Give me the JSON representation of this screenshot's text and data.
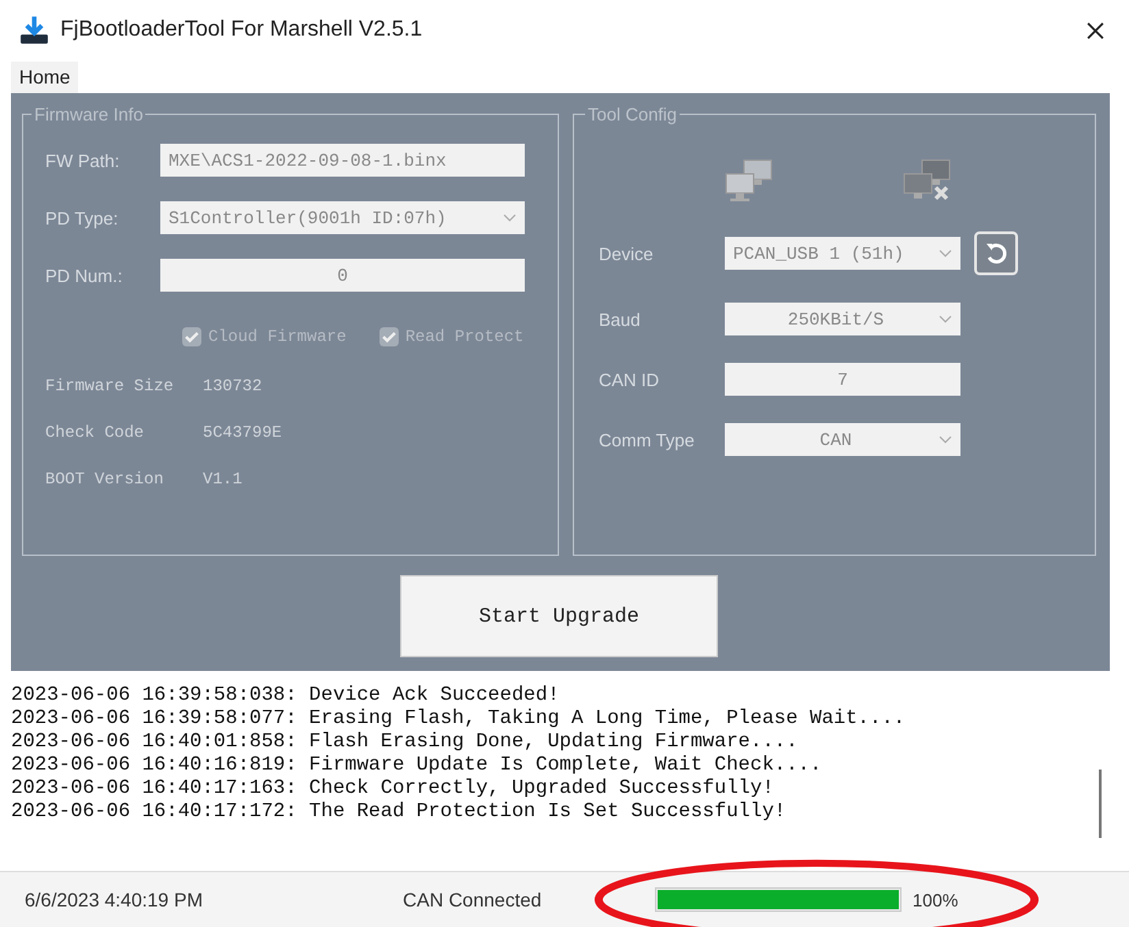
{
  "window": {
    "title": "FjBootloaderTool For Marshell V2.5.1"
  },
  "menu": [
    {
      "label": "Home",
      "selected": true
    }
  ],
  "firmware_info": {
    "title": "Firmware Info",
    "fields": [
      {
        "label": "FW Path:",
        "value": "MXE\\ACS1-2022-09-08-1.binx",
        "kind": "text"
      },
      {
        "label": "PD Type:",
        "value": "S1Controller(9001h ID:07h)",
        "kind": "dropdown"
      },
      {
        "label": "PD Num.:",
        "value": "0",
        "kind": "text"
      }
    ],
    "checkboxes": [
      {
        "label": "Cloud Firmware",
        "checked": true,
        "disabled": true
      },
      {
        "label": "Read Protect",
        "checked": true,
        "disabled": true
      }
    ],
    "info": [
      {
        "label": "Firmware Size",
        "value": "130732"
      },
      {
        "label": "Check Code",
        "value": "5C43799E"
      },
      {
        "label": "BOOT Version",
        "value": "V1.1"
      }
    ]
  },
  "tool_config": {
    "title": "Tool Config",
    "fields": [
      {
        "label": "Device",
        "value": "PCAN_USB 1 (51h)",
        "kind": "dropdown",
        "refresh": true
      },
      {
        "label": "Baud",
        "value": "250KBit/S",
        "kind": "dropdown",
        "refresh": false
      },
      {
        "label": "CAN ID",
        "value": "7",
        "kind": "text",
        "refresh": false
      },
      {
        "label": "Comm Type",
        "value": "CAN",
        "kind": "dropdown",
        "refresh": false
      }
    ]
  },
  "start_button": "Start Upgrade",
  "log": [
    "2023-06-06 16:39:58:038: Device Ack Succeeded!",
    "2023-06-06 16:39:58:077: Erasing Flash, Taking A Long Time, Please Wait....",
    "2023-06-06 16:40:01:858: Flash Erasing Done, Updating Firmware....",
    "2023-06-06 16:40:16:819: Firmware Update Is Complete, Wait Check....",
    "2023-06-06 16:40:17:163: Check Correctly, Upgraded Successfully!",
    "2023-06-06 16:40:17:172: The Read Protection Is Set Successfully!"
  ],
  "status_bar": {
    "datetime": "6/6/2023 4:40:19 PM",
    "connection": "CAN Connected",
    "progress": {
      "level": 1,
      "reading": "100%"
    }
  }
}
